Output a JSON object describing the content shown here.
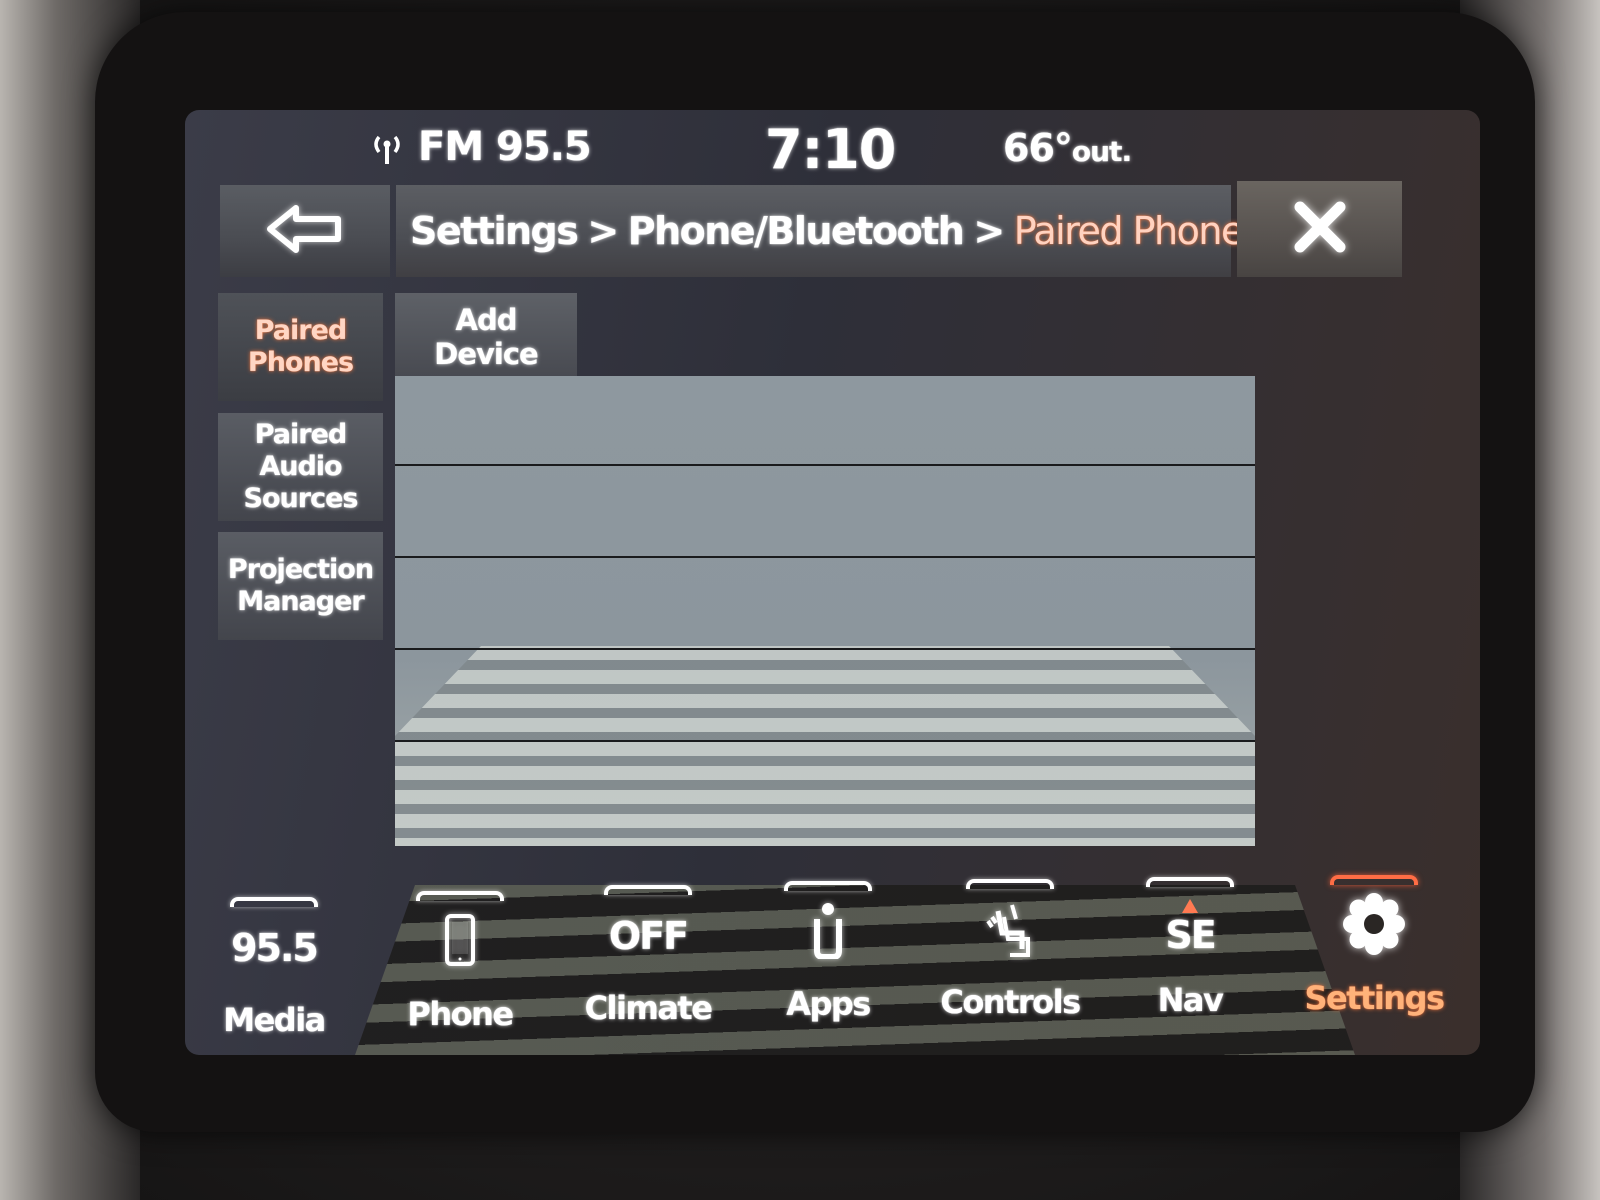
{
  "status_bar": {
    "radio_icon": "antenna-icon",
    "radio": "FM 95.5",
    "time": "7:10",
    "temperature": "66°",
    "temperature_suffix": "out."
  },
  "header": {
    "back_icon": "back-arrow-icon",
    "breadcrumb": [
      {
        "label": "Settings"
      },
      {
        "label": "Phone/Bluetooth"
      },
      {
        "label": "Paired Phones",
        "current": true
      }
    ],
    "separator": ">",
    "close_icon": "close-icon"
  },
  "side_tabs": [
    {
      "label_lines": [
        "Paired",
        "Phones"
      ],
      "active": true
    },
    {
      "label_lines": [
        "Paired",
        "Audio",
        "Sources"
      ],
      "active": false
    },
    {
      "label_lines": [
        "Projection",
        "Manager"
      ],
      "active": false
    }
  ],
  "actions": {
    "add_device_lines": [
      "Add",
      "Device"
    ]
  },
  "device_list": {
    "rows": [
      {
        "label": ""
      },
      {
        "label": ""
      },
      {
        "label": ""
      },
      {
        "label": ""
      },
      {
        "label": ""
      }
    ]
  },
  "bottom_nav": [
    {
      "label": "Media",
      "icon": "radio-frequency-icon",
      "icon_text": "95.5",
      "active": false
    },
    {
      "label": "Phone",
      "icon": "phone-icon",
      "icon_text": "",
      "active": false
    },
    {
      "label": "Climate",
      "icon": "climate-off-icon",
      "icon_text": "OFF",
      "active": false
    },
    {
      "label": "Apps",
      "icon": "apps-icon",
      "icon_text": "",
      "active": false
    },
    {
      "label": "Controls",
      "icon": "seat-controls-icon",
      "icon_text": "",
      "active": false
    },
    {
      "label": "Nav",
      "icon": "compass-icon",
      "icon_text": "SE",
      "active": false
    },
    {
      "label": "Settings",
      "icon": "gear-icon",
      "icon_text": "",
      "active": true
    }
  ],
  "colors": {
    "accent": "#ff6d45",
    "accent_text": "#ffb27a",
    "list_background": "#8e989f"
  }
}
